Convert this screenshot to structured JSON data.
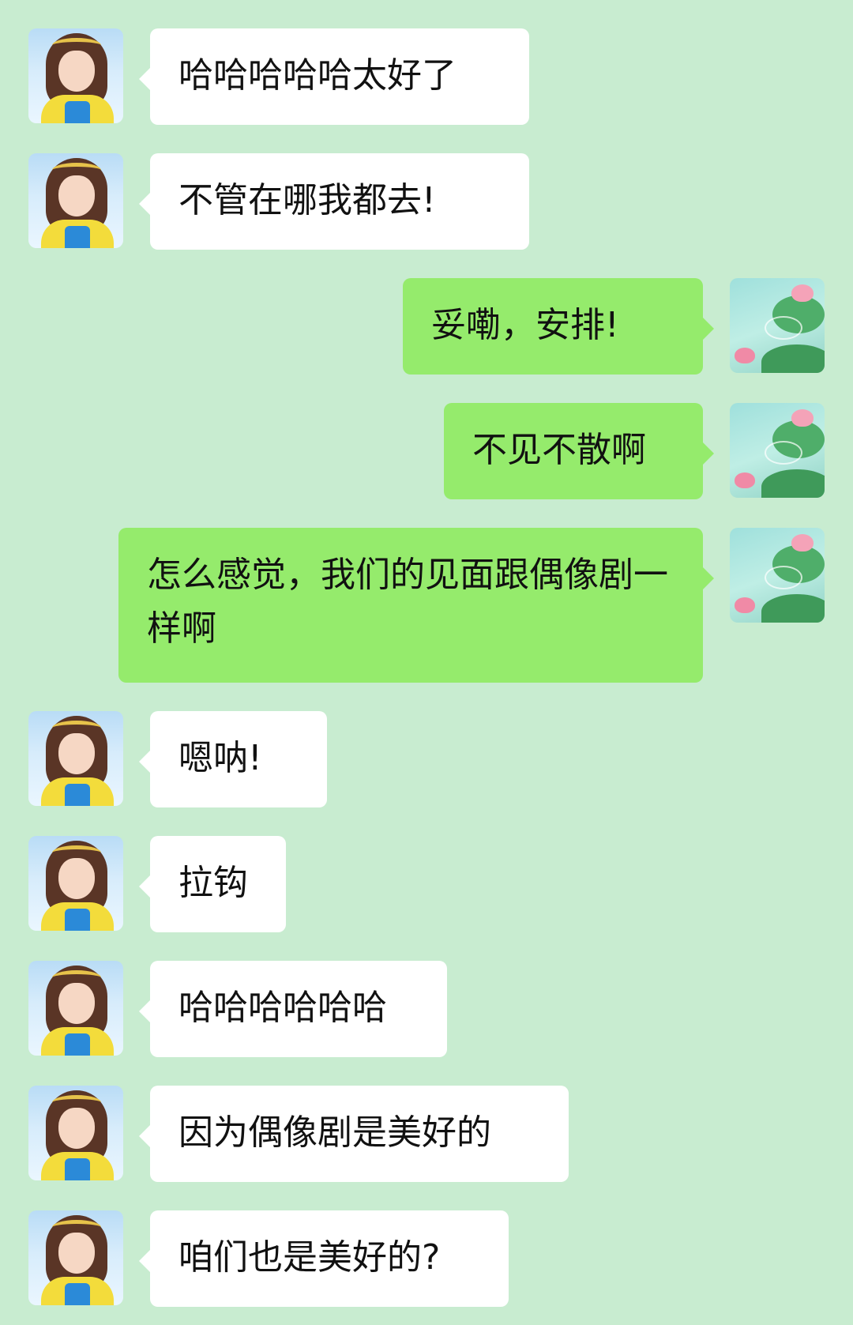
{
  "messages": [
    {
      "side": "left",
      "text": "哈哈哈哈哈太好了"
    },
    {
      "side": "left",
      "text": "不管在哪我都去!"
    },
    {
      "side": "right",
      "text": "妥嘞，安排!"
    },
    {
      "side": "right",
      "text": "不见不散啊"
    },
    {
      "side": "right",
      "text": "怎么感觉，我们的见面跟偶像剧一样啊"
    },
    {
      "side": "left",
      "text": "嗯呐!"
    },
    {
      "side": "left",
      "text": "拉钩"
    },
    {
      "side": "left",
      "text": "哈哈哈哈哈哈"
    },
    {
      "side": "left",
      "text": "因为偶像剧是美好的"
    },
    {
      "side": "left",
      "text": "咱们也是美好的?"
    }
  ],
  "avatars": {
    "left": "girl-avatar",
    "right": "lotus-avatar"
  },
  "colors": {
    "background": "#c8ecd0",
    "incoming_bubble": "#ffffff",
    "outgoing_bubble": "#95eb6c"
  }
}
